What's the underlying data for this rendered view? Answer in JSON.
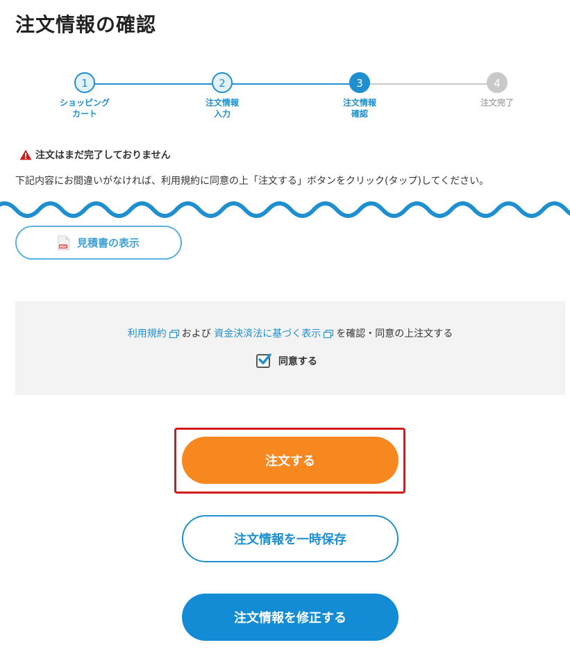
{
  "page": {
    "title": "注文情報の確認"
  },
  "stepper": {
    "steps": [
      {
        "number": "1",
        "label": "ショッピング\nカート",
        "state": "done"
      },
      {
        "number": "2",
        "label": "注文情報\n入力",
        "state": "done"
      },
      {
        "number": "3",
        "label": "注文情報\n確認",
        "state": "current"
      },
      {
        "number": "4",
        "label": "注文完了",
        "state": "todo"
      }
    ],
    "colors": {
      "active": "#1f8fcf",
      "inactive": "#c9c9c9"
    }
  },
  "notice": {
    "warning": "注文はまだ完了しておりません",
    "instruction": "下記内容にお間違いがなければ、利用規約に同意の上「注文する」ボタンをクリック(タップ)してください。"
  },
  "estimate": {
    "button_label": "見積書の表示",
    "icon": "pdf-file-icon",
    "icon_text": "PDF"
  },
  "agreement": {
    "terms_link": "利用規約",
    "and_text": "および",
    "law_link": "資金決済法に基づく表示",
    "suffix_text": "を確認・同意の上注文する",
    "checkbox_label": "同意する",
    "checked": true
  },
  "actions": {
    "order_label": "注文する",
    "save_label": "注文情報を一時保存",
    "edit_label": "注文情報を修正する"
  },
  "colors": {
    "accent": "#1f8fcf",
    "order_button": "#f7871f",
    "highlight_border": "#d11a1a",
    "warning_icon": "#d11a1a",
    "wave": "#1f8fcf"
  }
}
